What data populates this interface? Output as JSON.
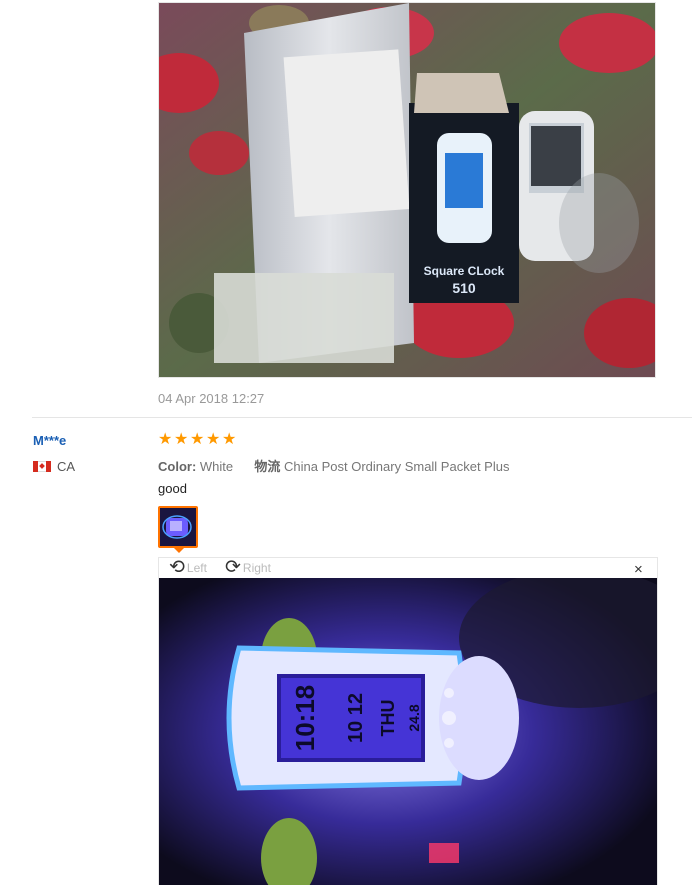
{
  "review1": {
    "date": "04 Apr 2018 12:27"
  },
  "review2": {
    "user_name": "M***e",
    "country": "CA",
    "rating": 5,
    "stars": [
      "★",
      "★",
      "★",
      "★",
      "★"
    ],
    "color_label": "Color:",
    "color_value": "White",
    "shipping_label": "物流",
    "shipping_value": "China Post Ordinary Small Packet Plus",
    "text": "good",
    "viewer": {
      "rotate_left_label": "Left",
      "rotate_right_label": "Right",
      "close_glyph": "×"
    }
  },
  "photo1": {
    "box_label_line1": "Square CLock",
    "box_label_line2": "510"
  },
  "photo2": {
    "clock_time": "10:18",
    "clock_date": "10 12",
    "clock_day": "THU",
    "clock_temp": "24.8"
  },
  "colors": {
    "link_blue": "#1a5fb4",
    "star_orange": "#ff9900",
    "thumb_border": "#ff7300"
  }
}
